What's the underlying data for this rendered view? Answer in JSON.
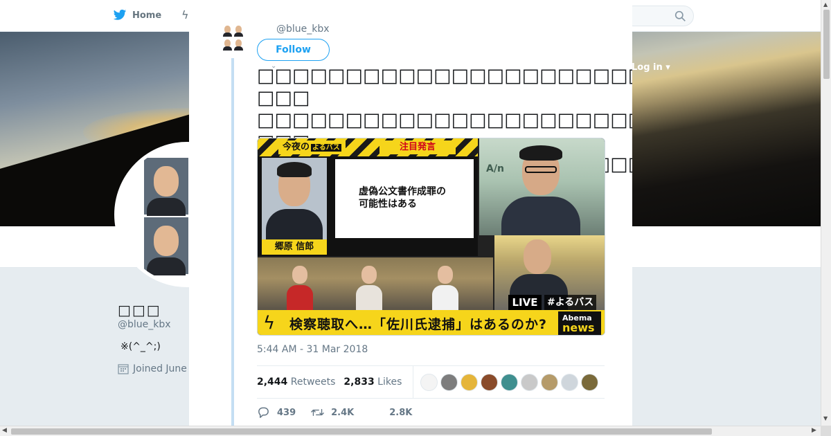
{
  "nav": {
    "home_label": "Home",
    "login_label": "Log in ▾"
  },
  "profile": {
    "name": "□□□",
    "handle": "@blue_kbx",
    "bio": "※(^_^;)",
    "joined": "Joined June"
  },
  "tweet": {
    "handle": "@blue_kbx",
    "follow_label": "Follow",
    "text_lines": [
      "□□□□□□□□□□□□□□□□□□□□□□□□□□□□□□□□□□□",
      "□□□□□□□□□□□□□□□□□□□□□□□□□□□□□□□□□□□",
      "□□□□□□□□□□□□□□□□□□□□□□□□□□□□□□□□□□□"
    ],
    "line3_text": "□□□□□□□□□□□□□□□□□□□□□□□□□□□□□□□□□□",
    "hashtag": "#□□□□",
    "timestamp": "5:44 AM - 31 Mar 2018",
    "retweets_count": "2,444",
    "retweets_label": "Retweets",
    "likes_count": "2,833",
    "likes_label": "Likes",
    "replies_short": "439",
    "retweets_short": "2.4K",
    "likes_short": "2.8K"
  },
  "media": {
    "header_left": "今夜の",
    "header_logo": "よるバス",
    "header_right": "注目発言",
    "quote": "虚偽公文書作成罪の\n可能性はある",
    "name_tag": "郷原 信郎",
    "top_right_logo": "A/n",
    "live_label": "LIVE",
    "hashtag_label": "#よるバス",
    "ticker": "検察聴取へ…「佐川氏逮捕」はあるのか?",
    "brand_top": "Abema",
    "brand_bottom": "news"
  },
  "liker_colors": [
    "#f4f4f4",
    "#7d7d7d",
    "#e5b53a",
    "#8a4b2a",
    "#3f8f8f",
    "#c9c9c9",
    "#b59b6a",
    "#cfd6dc",
    "#7a6a3a"
  ],
  "colors": {
    "accent": "#1da1f2",
    "hashtag": "#1b95e0",
    "thread_line": "#c4def3"
  },
  "controls": {
    "close_glyph": "✕"
  }
}
